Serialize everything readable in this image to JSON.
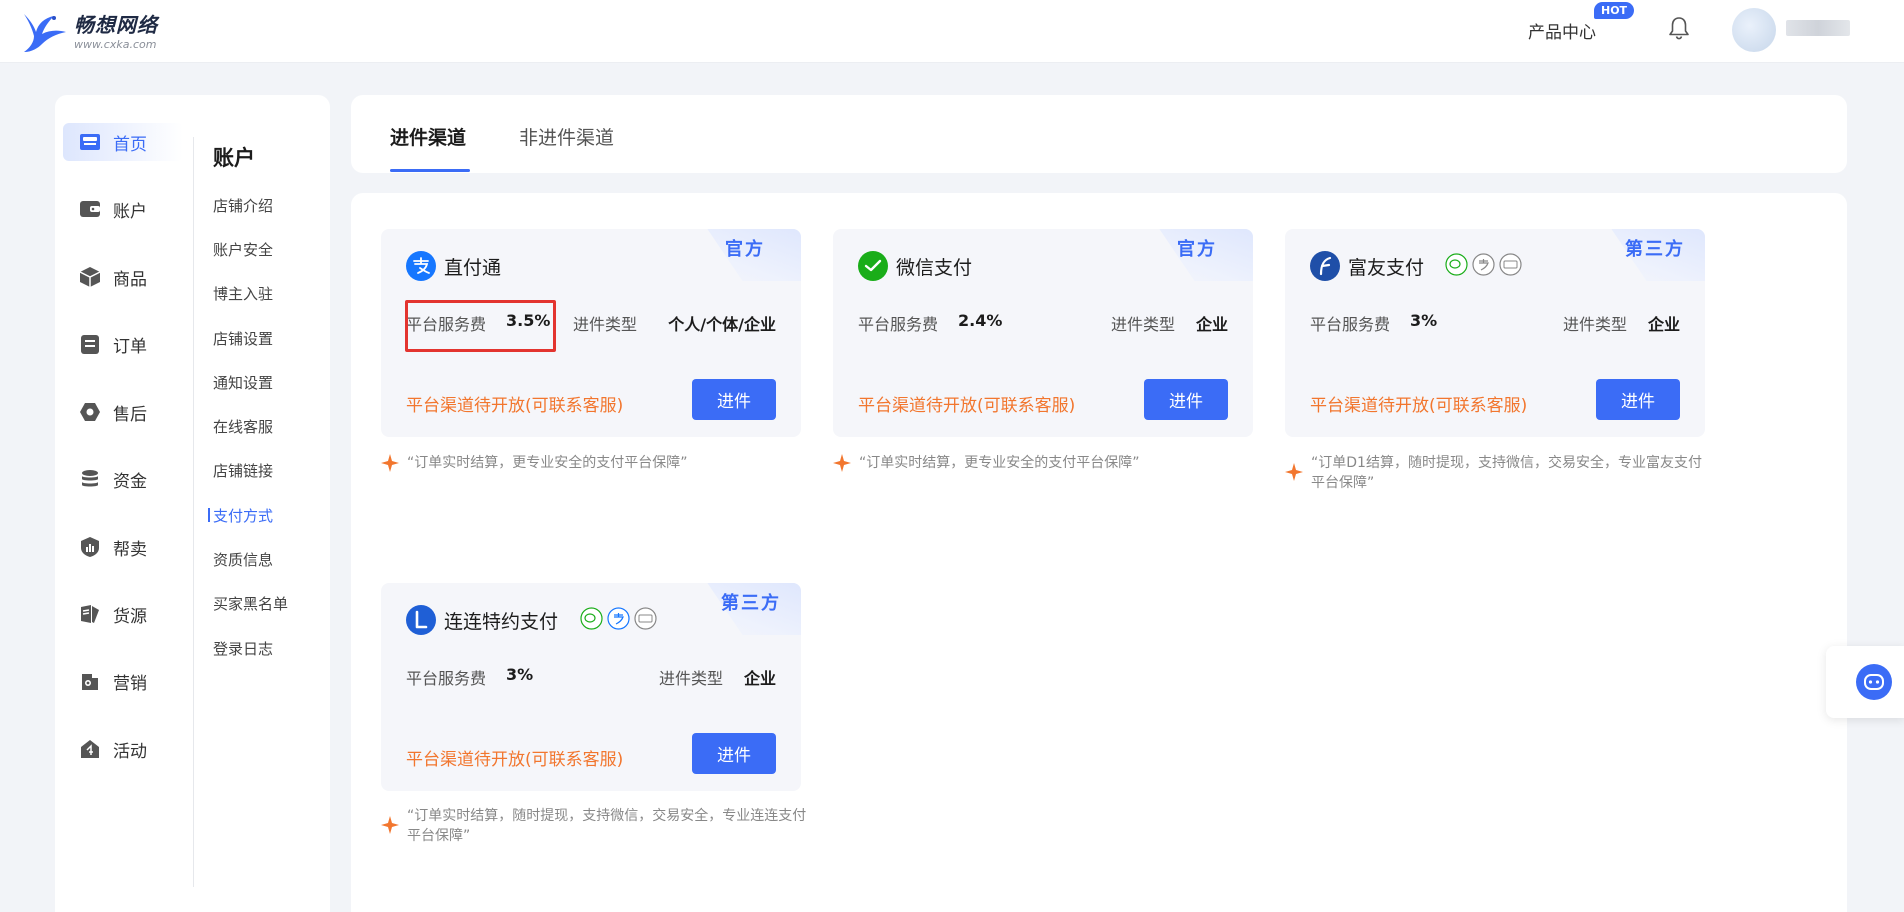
{
  "brand": {
    "name": "畅想网络",
    "url_text": "www.cxka.com"
  },
  "header": {
    "product_center": "产品中心",
    "hot_badge": "HOT"
  },
  "main_nav": [
    {
      "label": "首页",
      "icon": "store-icon",
      "active": true
    },
    {
      "label": "账户",
      "icon": "wallet-icon"
    },
    {
      "label": "商品",
      "icon": "box-icon"
    },
    {
      "label": "订单",
      "icon": "clipboard-icon"
    },
    {
      "label": "售后",
      "icon": "hexagon-icon"
    },
    {
      "label": "资金",
      "icon": "coins-icon"
    },
    {
      "label": "帮卖",
      "icon": "chart-shield-icon"
    },
    {
      "label": "货源",
      "icon": "source-icon"
    },
    {
      "label": "营销",
      "icon": "marketing-icon"
    },
    {
      "label": "活动",
      "icon": "activity-icon"
    }
  ],
  "sub_nav": {
    "title": "账户",
    "items": [
      {
        "label": "店铺介绍"
      },
      {
        "label": "账户安全"
      },
      {
        "label": "博主入驻"
      },
      {
        "label": "店铺设置"
      },
      {
        "label": "通知设置"
      },
      {
        "label": "在线客服"
      },
      {
        "label": "店铺链接"
      },
      {
        "label": "支付方式",
        "active": true
      },
      {
        "label": "资质信息"
      },
      {
        "label": "买家黑名单"
      },
      {
        "label": "登录日志"
      }
    ]
  },
  "tabs": [
    {
      "label": "进件渠道",
      "active": true
    },
    {
      "label": "非进件渠道"
    }
  ],
  "colors": {
    "accent": "#3b6cf6",
    "pending": "#f2762e",
    "highlight": "#e3342f",
    "wechat": "#1aad19"
  },
  "cards": [
    {
      "name": "直付通",
      "tag": "官方",
      "logo": "alipay-icon",
      "fee_label": "平台服务费",
      "fee_value": "3.5%",
      "type_label": "进件类型",
      "type_value": "个人/个体/企业",
      "pending": "平台渠道待开放(可联系客服)",
      "button": "进件",
      "note": "“订单实时结算，更专业安全的支付平台保障”"
    },
    {
      "name": "微信支付",
      "tag": "官方",
      "logo": "wechat-pay-icon",
      "fee_label": "平台服务费",
      "fee_value": "2.4%",
      "type_label": "进件类型",
      "type_value": "企业",
      "pending": "平台渠道待开放(可联系客服)",
      "button": "进件",
      "note": "“订单实时结算，更专业安全的支付平台保障”"
    },
    {
      "name": "富友支付",
      "tag": "第三方",
      "logo": "fuiou-icon",
      "mini_icons": [
        "wechat-mini-icon",
        "alipay-mini-icon",
        "unionpay-mini-icon"
      ],
      "fee_label": "平台服务费",
      "fee_value": "3%",
      "type_label": "进件类型",
      "type_value": "企业",
      "pending": "平台渠道待开放(可联系客服)",
      "button": "进件",
      "note": "“订单D1结算，随时提现，支持微信，交易安全，专业富友支付平台保障”"
    },
    {
      "name": "连连特约支付",
      "tag": "第三方",
      "logo": "lianlian-icon",
      "mini_icons": [
        "wechat-mini-icon",
        "alipay-mini-icon",
        "unionpay-mini-icon"
      ],
      "fee_label": "平台服务费",
      "fee_value": "3%",
      "type_label": "进件类型",
      "type_value": "企业",
      "pending": "平台渠道待开放(可联系客服)",
      "button": "进件",
      "note": "“订单实时结算，随时提现，支持微信，交易安全，专业连连支付平台保障”"
    }
  ]
}
